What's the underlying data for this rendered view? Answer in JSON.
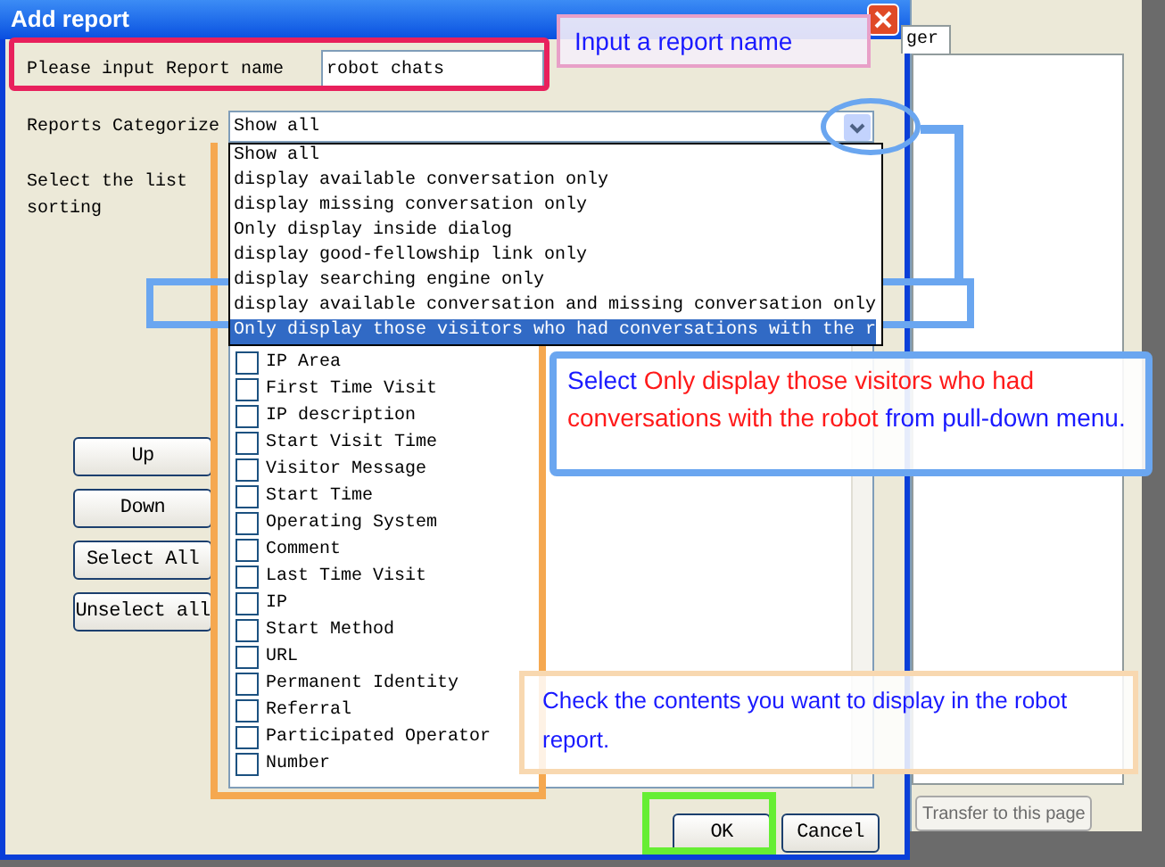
{
  "dialog": {
    "title": "Add report",
    "name_label": "Please input Report name",
    "name_value": "robot chats",
    "category_label": "Reports Categorize",
    "category_value": "Show all",
    "sort_label": "Select the list sorting",
    "buttons": [
      "Up",
      "Down",
      "Select All",
      "Unselect all"
    ],
    "ok": "OK",
    "cancel": "Cancel"
  },
  "dropdown": [
    {
      "label": "Show all",
      "selected": false
    },
    {
      "label": "display available conversation only",
      "selected": false
    },
    {
      "label": "display missing conversation only",
      "selected": false
    },
    {
      "label": "Only display inside dialog",
      "selected": false
    },
    {
      "label": "display good-fellowship link only",
      "selected": false
    },
    {
      "label": "display searching engine only",
      "selected": false
    },
    {
      "label": "display available conversation and missing conversation only",
      "selected": false
    },
    {
      "label": "Only display those visitors who had conversations with the r",
      "selected": true
    }
  ],
  "fields": [
    {
      "label": "IP Area",
      "checked": false
    },
    {
      "label": "First Time Visit",
      "checked": false
    },
    {
      "label": "IP description",
      "checked": false
    },
    {
      "label": "Start Visit Time",
      "checked": false
    },
    {
      "label": "Visitor Message",
      "checked": false
    },
    {
      "label": "Start Time",
      "checked": false
    },
    {
      "label": "Operating System",
      "checked": false
    },
    {
      "label": "Comment",
      "checked": false
    },
    {
      "label": "Last Time Visit",
      "checked": false
    },
    {
      "label": "IP",
      "checked": false
    },
    {
      "label": "Start Method",
      "checked": false
    },
    {
      "label": "URL",
      "checked": false
    },
    {
      "label": "Permanent Identity",
      "checked": false
    },
    {
      "label": "Referral",
      "checked": false
    },
    {
      "label": "Participated Operator",
      "checked": false
    },
    {
      "label": "Number",
      "checked": false
    }
  ],
  "background_window": {
    "tab": "ger",
    "button": "Transfer to this page"
  },
  "annotations": {
    "name_note": "Input a report name",
    "select_note": [
      {
        "text": "Select ",
        "kind": "plain"
      },
      {
        "text": "Only display those visitors who had conversations with the robot",
        "kind": "highlight"
      },
      {
        "text": " from pull-down menu.",
        "kind": "plain"
      }
    ],
    "check_note": "Check the contents you want to display in the robot report."
  }
}
